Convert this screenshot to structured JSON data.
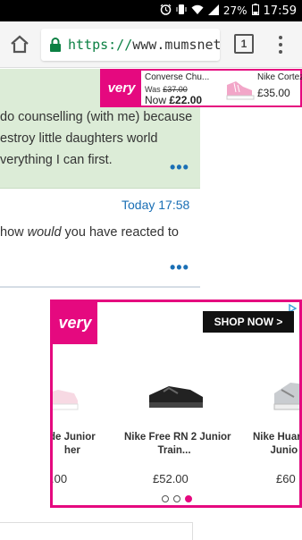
{
  "status_bar": {
    "battery_pct": "27%",
    "time": "17:59"
  },
  "browser": {
    "url_scheme": "https://",
    "url_host": "www.mumsnet.co",
    "tab_count": "1"
  },
  "ad_top": {
    "brand": "very",
    "product1": "Converse Chu...",
    "was_label": "Was",
    "was_price": "£37.00",
    "now_label": "Now",
    "now_price": "£22.00",
    "product2": "Nike Cortez",
    "product2_price": "£35.00"
  },
  "thread": {
    "post1_lines": [
      "do counselling (with me) because",
      "estroy little daughters world",
      "verything I can first."
    ],
    "post2_time": "Today 17:58",
    "post2_text_before": "how ",
    "post2_text_em": "would",
    "post2_text_after": " you have reacted to",
    "more": "•••"
  },
  "ad_big": {
    "brand": "very",
    "cta": "SHOP NOW >",
    "items": [
      {
        "name_line1": "de Junior",
        "name_line2": "her",
        "price": ".00"
      },
      {
        "name_line1": "Nike Free RN 2 Junior",
        "name_line2": "Train...",
        "price": "£52.00"
      },
      {
        "name_line1": "Nike Huar",
        "name_line2": "Junio",
        "price": "£60"
      }
    ]
  },
  "colors": {
    "accent_pink": "#e5097f",
    "link_blue": "#1a6fb5",
    "post_green": "#dcecd7"
  }
}
